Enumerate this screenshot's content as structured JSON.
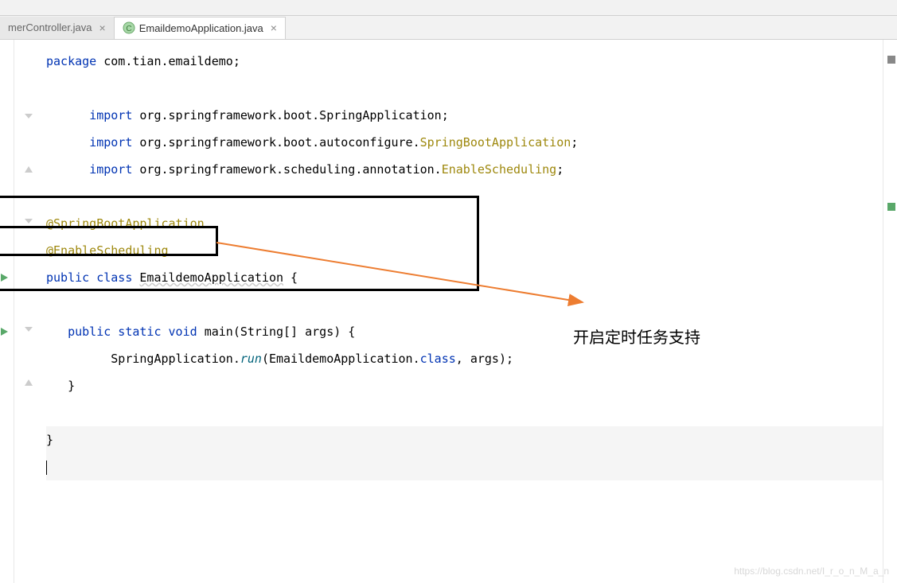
{
  "tabs": [
    {
      "label": "merController.java",
      "active": false
    },
    {
      "label": "EmaildemoApplication.java",
      "active": true
    }
  ],
  "code": {
    "l1_kw": "package ",
    "l1_pkg": "com.tian.emaildemo",
    "l1_end": ";",
    "l3_kw": "import ",
    "l3_pkg": "org.springframework.boot.SpringApplication",
    "l3_end": ";",
    "l4_kw": "import ",
    "l4_pkg": "org.springframework.boot.autoconfigure.",
    "l4_cls": "SpringBootApplication",
    "l4_end": ";",
    "l5_kw": "import ",
    "l5_pkg": "org.springframework.scheduling.annotation.",
    "l5_cls": "EnableScheduling",
    "l5_end": ";",
    "l7_annot": "@SpringBootApplication",
    "l8_annot": "@EnableScheduling",
    "l9_kw1": "public class ",
    "l9_cls": "EmaildemoApplication",
    "l9_brace": " {",
    "l11_kw": "public static void ",
    "l11_main": "main",
    "l11_params": "(String[] args) {",
    "l12_spring": "SpringApplication",
    "l12_dot": ".",
    "l12_run": "run",
    "l12_args1": "(EmaildemoApplication.",
    "l12_class": "class",
    "l12_args2": ", args);",
    "l13_brace": "}",
    "l15_brace": "}"
  },
  "annotation": {
    "text": "开启定时任务支持"
  },
  "watermark": "https://blog.csdn.net/I_r_o_n_M_a_n"
}
